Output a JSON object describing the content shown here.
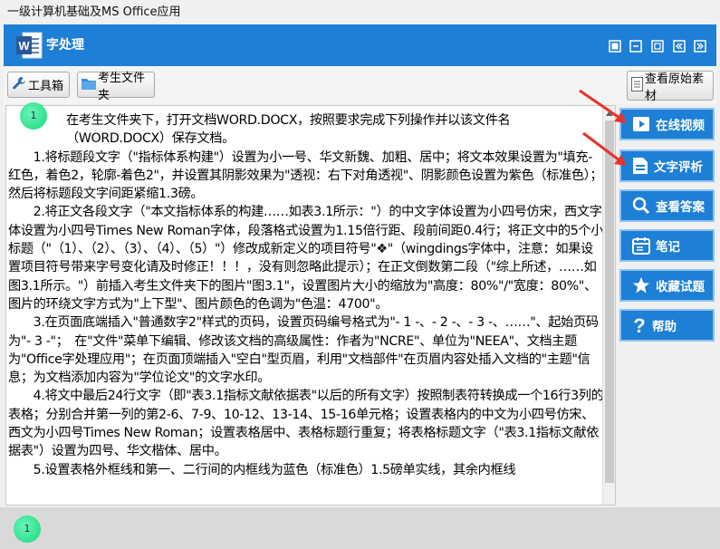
{
  "window_title": "一级计算机基础及MS Office应用",
  "header": {
    "app_name": "字处理",
    "logo_letter": "W",
    "controls": [
      "grid-icon",
      "minimize-icon",
      "restore-icon",
      "prev-icon",
      "next-icon"
    ]
  },
  "toolbar": {
    "toolbox_label": "工具箱",
    "folder_label": "考生文件夹",
    "view_source_label": "查看原始素材"
  },
  "sidebar": {
    "items": [
      {
        "label": "在线视频",
        "icon": "video-icon"
      },
      {
        "label": "文字评析",
        "icon": "document-icon"
      },
      {
        "label": "查看答案",
        "icon": "search-icon"
      },
      {
        "label": "笔记",
        "icon": "calendar-icon"
      },
      {
        "label": "收藏试题",
        "icon": "star-icon"
      },
      {
        "label": "帮助",
        "icon": "question-icon"
      }
    ]
  },
  "badge_top": "1",
  "badge_bottom": "1",
  "document": {
    "paragraphs": [
      "在考生文件夹下，打开文档WORD.DOCX，按照要求完成下列操作并以该文件名（WORD.DOCX）保存文档。",
      "　　1.将标题段文字（\"指标体系构建\"）设置为小一号、华文新魏、加粗、居中；将文本效果设置为\"填充-红色，着色2，轮廓-着色2\"，并设置其阴影效果为\"透视：右下对角透视\"、阴影颜色设置为紫色（标准色）；然后将标题段文字间距紧缩1.3磅。",
      "　　2.将正文各段文字（\"本文指标体系的构建……如表3.1所示：\"）的中文字体设置为小四号仿宋，西文字体设置为小四号Times New Roman字体，段落格式设置为1.15倍行距、段前间距0.4行；将正文中的5个小标题（\"（1）、（2）、（3）、（4）、（5）\"）修改成新定义的项目符号\"❖\"（wingdings字体中，注意：如果设置项目符号带来字号变化请及时修正！！！，没有则忽略此提示）；在正文倒数第二段（\"综上所述，……如图3.1所示。\"）前插入考生文件夹下的图片\"图3.1\"，设置图片大小的缩放为\"高度：80%\"/\"宽度：80%\"、图片的环绕文字方式为\"上下型\"、图片颜色的色调为\"色温：4700\"。",
      "　　3.在页面底端插入\"普通数字2\"样式的页码，设置页码编号格式为\"- 1 -、- 2 -、- 3 -、……\"、起始页码为\"- 3 -\"；　在\"文件\"菜单下编辑、修改该文档的高级属性：作者为\"NCRE\"、单位为\"NEEA\"、文档主题为\"Office字处理应用\"；在页面顶端插入\"空白\"型页眉，利用\"文档部件\"在页眉内容处插入文档的\"主题\"信息；为文档添加内容为\"学位论文\"的文字水印。",
      "　　4.将文中最后24行文字（即\"表3.1指标文献依据表\"以后的所有文字）按照制表符转换成一个16行3列的表格；分别合并第一列的第2-6、7-9、10-12、13-14、15-16单元格；设置表格内的中文为小四号仿宋、西文为小四号Times New Roman；设置表格居中、表格标题行重复；将表格标题文字（\"表3.1指标文献依据表\"）设置为四号、华文楷体、居中。",
      "　　5.设置表格外框线和第一、二行间的内框线为蓝色（标准色）1.5磅单实线，其余内框线"
    ]
  },
  "colors": {
    "header_blue": "#1e7fd6",
    "annotation_arrow": "#e8322a",
    "badge_green": "#17d97c"
  }
}
